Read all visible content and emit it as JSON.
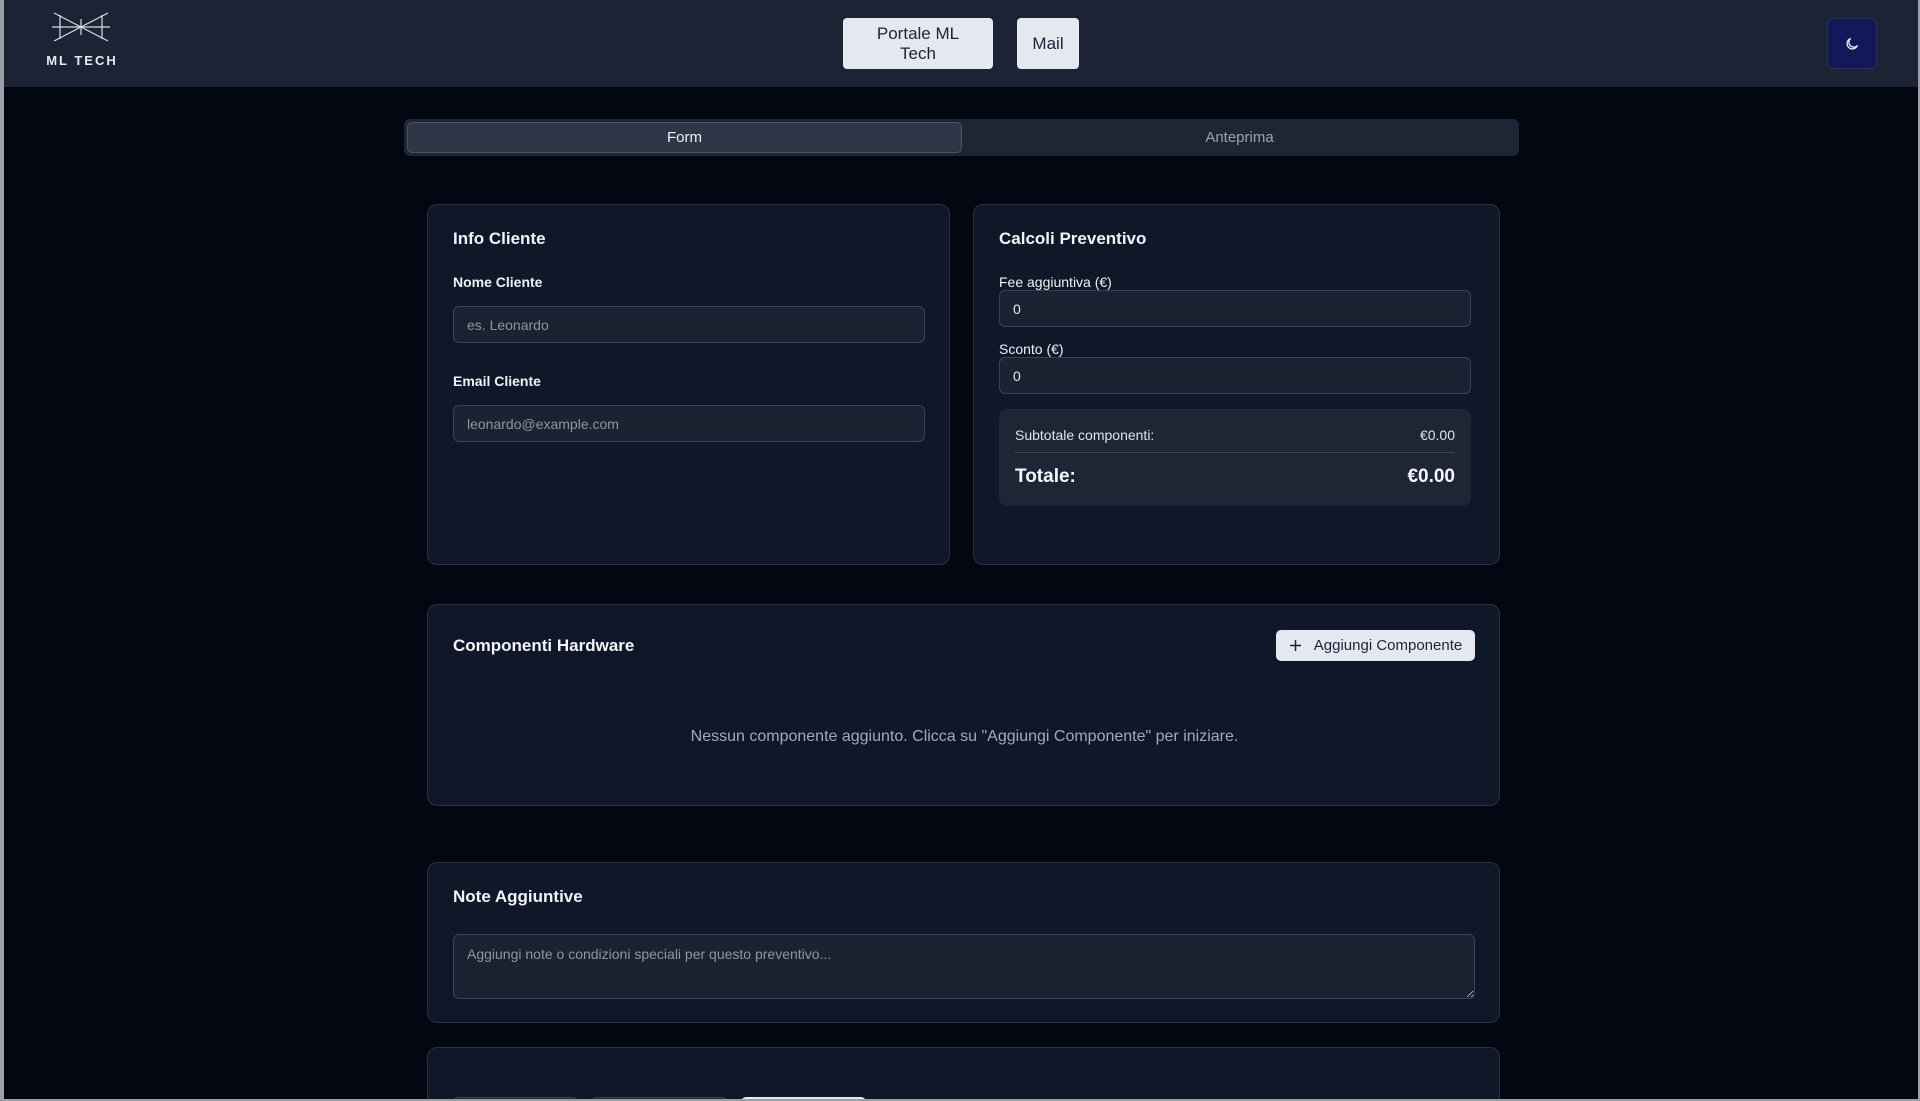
{
  "header": {
    "logo_text": "ML TECH",
    "nav": [
      {
        "label": "Portale ML Tech"
      },
      {
        "label": "Mail"
      }
    ],
    "theme_toggle_icon": "moon-icon"
  },
  "tabs": [
    {
      "label": "Form",
      "active": true
    },
    {
      "label": "Anteprima",
      "active": false
    }
  ],
  "client": {
    "title": "Info Cliente",
    "name_label": "Nome Cliente",
    "name_placeholder": "es. Leonardo",
    "email_label": "Email Cliente",
    "email_placeholder": "leonardo@example.com"
  },
  "calc": {
    "title": "Calcoli Preventivo",
    "fee_label": "Fee aggiuntiva (€)",
    "fee_value": "0",
    "discount_label": "Sconto (€)",
    "discount_value": "0",
    "subtotal_label": "Subtotale componenti:",
    "subtotal_value": "€0.00",
    "total_label": "Totale:",
    "total_value": "€0.00"
  },
  "hardware": {
    "title": "Componenti Hardware",
    "add_label": "Aggiungi Componente",
    "add_icon": "plus-icon",
    "empty_message": "Nessun componente aggiunto. Clicca su \"Aggiungi Componente\" per iniziare."
  },
  "notes": {
    "title": "Note Aggiuntive",
    "placeholder": "Aggiungi note o condizioni speciali per questo preventivo..."
  },
  "colors": {
    "page_bg": "#030712",
    "header_bg": "#1b2334",
    "card_bg": "#101728",
    "theme_button_bg": "#13185a"
  }
}
